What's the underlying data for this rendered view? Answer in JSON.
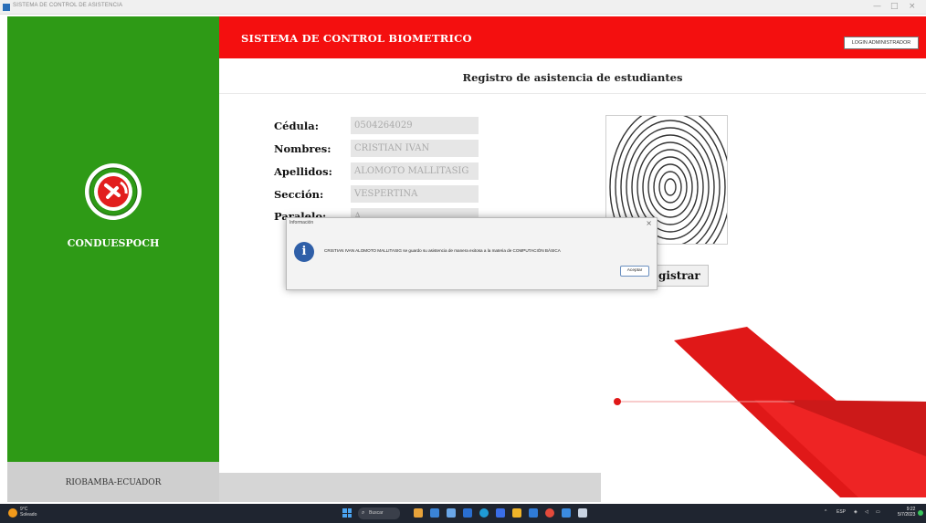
{
  "window": {
    "title": "SISTEMA DE CONTROL DE ASISTENCIA",
    "minimize": "—",
    "maximize": "□",
    "close": "×"
  },
  "sidebar": {
    "brand": "CONDUESPOCH",
    "footer": "RIOBAMBA-ECUADOR",
    "color": "#2e9a16"
  },
  "header": {
    "title": "SISTEMA DE CONTROL BIOMETRICO",
    "login_button": "LOGIN ADMINISTRADOR",
    "color": "#f40f0f"
  },
  "page": {
    "subtitle": "Registro de asistencia de estudiantes"
  },
  "form": {
    "fields": [
      {
        "label": "Cédula:",
        "value": "0504264029"
      },
      {
        "label": "Nombres:",
        "value": "CRISTIAN IVAN"
      },
      {
        "label": "Apellidos:",
        "value": "ALOMOTO MALLITASIG"
      },
      {
        "label": "Sección:",
        "value": "VESPERTINA"
      },
      {
        "label": "Paralelo:",
        "value": "A"
      }
    ],
    "register_button": "Registrar",
    "register_visible": "gistrar"
  },
  "dialog": {
    "title": "Información",
    "icon": "info-icon",
    "message": "CRISTIAN IVAN ALOMOTO MALLITASIG se guardo su asistencia de manera exitosa a la materia de COMPUTACIÓN BÁSICA",
    "ok_button": "Aceptar",
    "close": "×"
  },
  "taskbar": {
    "weather_temp": "9°C",
    "weather_desc": "Soleado",
    "search_placeholder": "Buscar",
    "language": "ESP",
    "time": "9:22",
    "date": "5/7/2023"
  }
}
